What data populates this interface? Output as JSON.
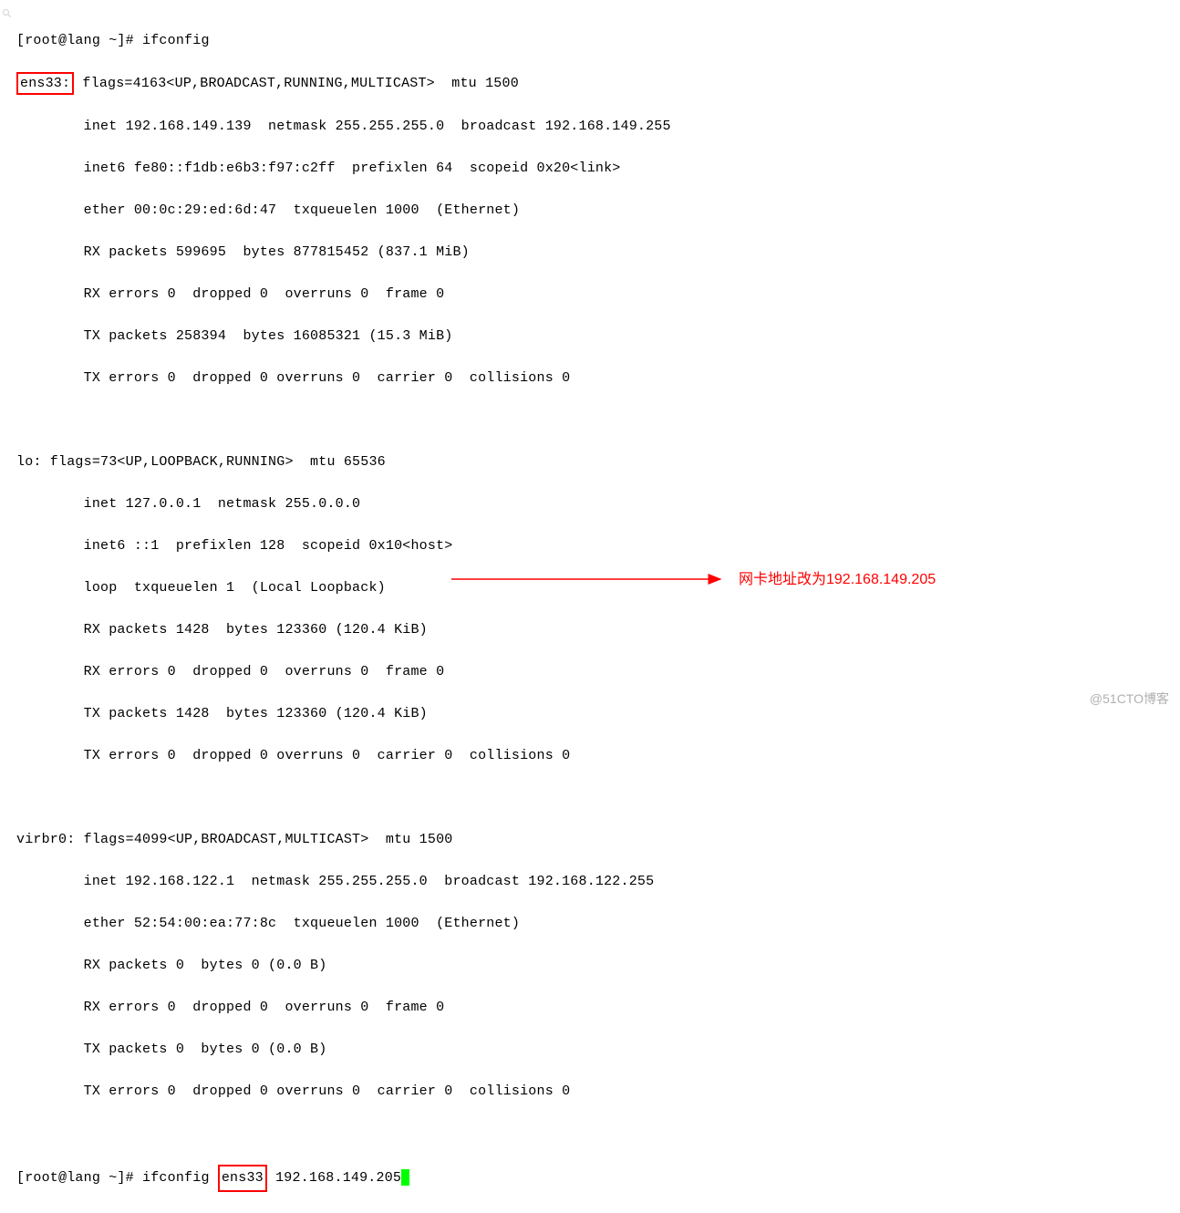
{
  "prompt1_prefix": "[root@lang ~]# ",
  "prompt1_cmd": "ifconfig",
  "iface1_name": "ens33:",
  "iface1_flags": " flags=4163<UP,BROADCAST,RUNNING,MULTICAST>  mtu 1500",
  "iface1_lines": [
    "        inet 192.168.149.139  netmask 255.255.255.0  broadcast 192.168.149.255",
    "        inet6 fe80::f1db:e6b3:f97:c2ff  prefixlen 64  scopeid 0x20<link>",
    "        ether 00:0c:29:ed:6d:47  txqueuelen 1000  (Ethernet)",
    "        RX packets 599695  bytes 877815452 (837.1 MiB)",
    "        RX errors 0  dropped 0  overruns 0  frame 0",
    "        TX packets 258394  bytes 16085321 (15.3 MiB)",
    "        TX errors 0  dropped 0 overruns 0  carrier 0  collisions 0"
  ],
  "iface2_lines": [
    "lo: flags=73<UP,LOOPBACK,RUNNING>  mtu 65536",
    "        inet 127.0.0.1  netmask 255.0.0.0",
    "        inet6 ::1  prefixlen 128  scopeid 0x10<host>",
    "        loop  txqueuelen 1  (Local Loopback)",
    "        RX packets 1428  bytes 123360 (120.4 KiB)",
    "        RX errors 0  dropped 0  overruns 0  frame 0",
    "        TX packets 1428  bytes 123360 (120.4 KiB)",
    "        TX errors 0  dropped 0 overruns 0  carrier 0  collisions 0"
  ],
  "iface3_lines": [
    "virbr0: flags=4099<UP,BROADCAST,MULTICAST>  mtu 1500",
    "        inet 192.168.122.1  netmask 255.255.255.0  broadcast 192.168.122.255",
    "        ether 52:54:00:ea:77:8c  txqueuelen 1000  (Ethernet)",
    "        RX packets 0  bytes 0 (0.0 B)",
    "        RX errors 0  dropped 0  overruns 0  frame 0",
    "        TX packets 0  bytes 0 (0.0 B)",
    "        TX errors 0  dropped 0 overruns 0  carrier 0  collisions 0"
  ],
  "prompt2_prefix": "[root@lang ~]# ",
  "prompt2_cmd1": "ifconfig ",
  "prompt2_iface": "ens33",
  "prompt2_cmd2": " 192.168.149.205",
  "annotation_text": "网卡地址改为192.168.149.205",
  "watermark": "@51CTO博客"
}
